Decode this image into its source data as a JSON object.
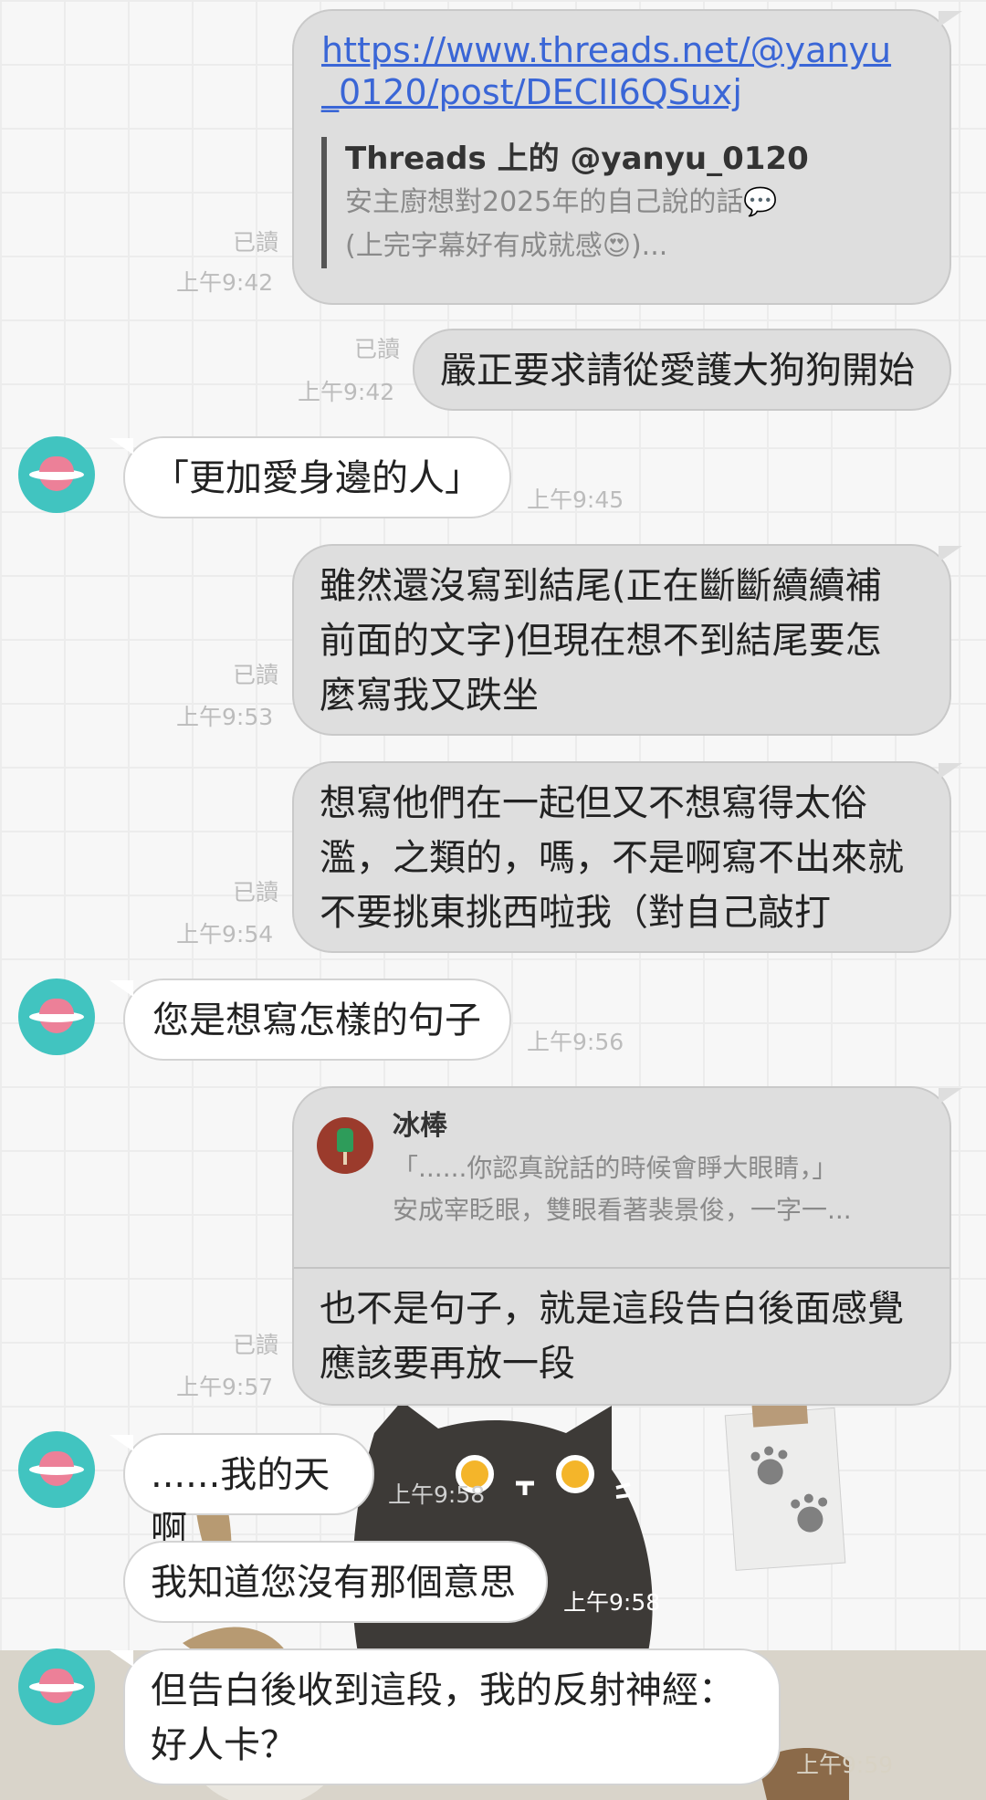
{
  "messages": {
    "m1": {
      "link_line1": "https://www.threads.net/@yanyu",
      "link_line2": "_0120/post/DECII6QSuxj",
      "preview_title": "Threads 上的 @yanyu_0120",
      "preview_line1": "安主廚想對2025年的自己說的話💬",
      "preview_line2": "(上完字幕好有成就感😍)...",
      "read": "已讀",
      "time": "上午9:42"
    },
    "m2": {
      "text": "嚴正要求請從愛護大狗狗開始",
      "read": "已讀",
      "time": "上午9:42"
    },
    "m3": {
      "text": "「更加愛身邊的人」",
      "time": "上午9:45"
    },
    "m4": {
      "line1": "雖然還沒寫到結尾(正在斷斷續續補",
      "line2": "前面的文字)但現在想不到結尾要怎",
      "line3": "麼寫我又跌坐",
      "read": "已讀",
      "time": "上午9:53"
    },
    "m5": {
      "line1": "想寫他們在一起但又不想寫得太俗",
      "line2": "濫，之類的，嗎，不是啊寫不出來就",
      "line3": "不要挑東挑西啦我（對自己敲打",
      "read": "已讀",
      "time": "上午9:54"
    },
    "m6": {
      "text": "您是想寫怎樣的句子",
      "time": "上午9:56"
    },
    "m7": {
      "reply_name": "冰棒",
      "reply_line1": "「......你認真說話的時候會睜大眼睛，」",
      "reply_line2": "安成宰眨眼，雙眼看著裴景俊，一字一...",
      "line1": "也不是句子，就是這段告白後面感覺",
      "line2": "應該要再放一段",
      "read": "已讀",
      "time": "上午9:57"
    },
    "m8": {
      "text": "......我的天啊",
      "time": "上午9:58"
    },
    "m9": {
      "text": "我知道您沒有那個意思",
      "time": "上午9:58"
    },
    "m10": {
      "line1": "但告白後收到這段，我的反射神經：",
      "line2": "好人卡？",
      "time": "上午9:59"
    }
  },
  "icons": {
    "avatar": "planet-avatar-icon",
    "reply_avatar": "popsicle-icon",
    "sticker": "black-cat-sticker"
  },
  "colors": {
    "avatar_bg": "#41c4c0",
    "planet": "#ec8098",
    "link": "#3a66d6",
    "reply_avatar_bg": "#9b3b2c",
    "popsicle": "#2e9c5a"
  }
}
